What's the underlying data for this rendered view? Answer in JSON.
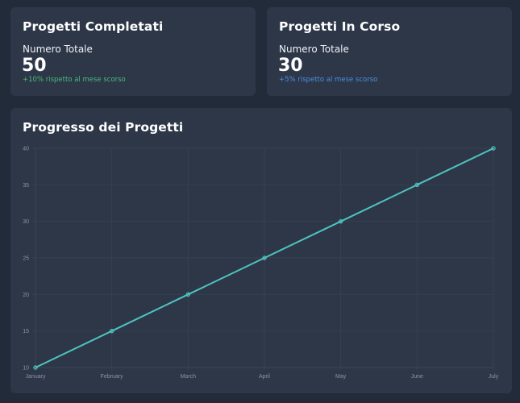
{
  "cards": {
    "completed": {
      "title": "Progetti Completati",
      "label": "Numero Totale",
      "value": "50",
      "change": "+10% rispetto al mese scorso",
      "change_color": "#48bb78"
    },
    "in_progress": {
      "title": "Progetti In Corso",
      "label": "Numero Totale",
      "value": "30",
      "change": "+5% rispetto al mese scorso",
      "change_color": "#4a90e2"
    }
  },
  "chart_panel": {
    "title": "Progresso dei Progetti"
  },
  "colors": {
    "background": "#222b39",
    "card": "#2d3748",
    "series": "#4fc3c0"
  },
  "chart_data": {
    "type": "line",
    "title": "Progresso dei Progetti",
    "xlabel": "",
    "ylabel": "",
    "categories": [
      "January",
      "February",
      "March",
      "April",
      "May",
      "June",
      "July"
    ],
    "series": [
      {
        "values": [
          10,
          15,
          20,
          25,
          30,
          35,
          40
        ]
      }
    ],
    "ylim": [
      10,
      40
    ],
    "yticks": [
      10,
      15,
      20,
      25,
      30,
      35,
      40
    ],
    "grid": true,
    "legend": "none"
  }
}
